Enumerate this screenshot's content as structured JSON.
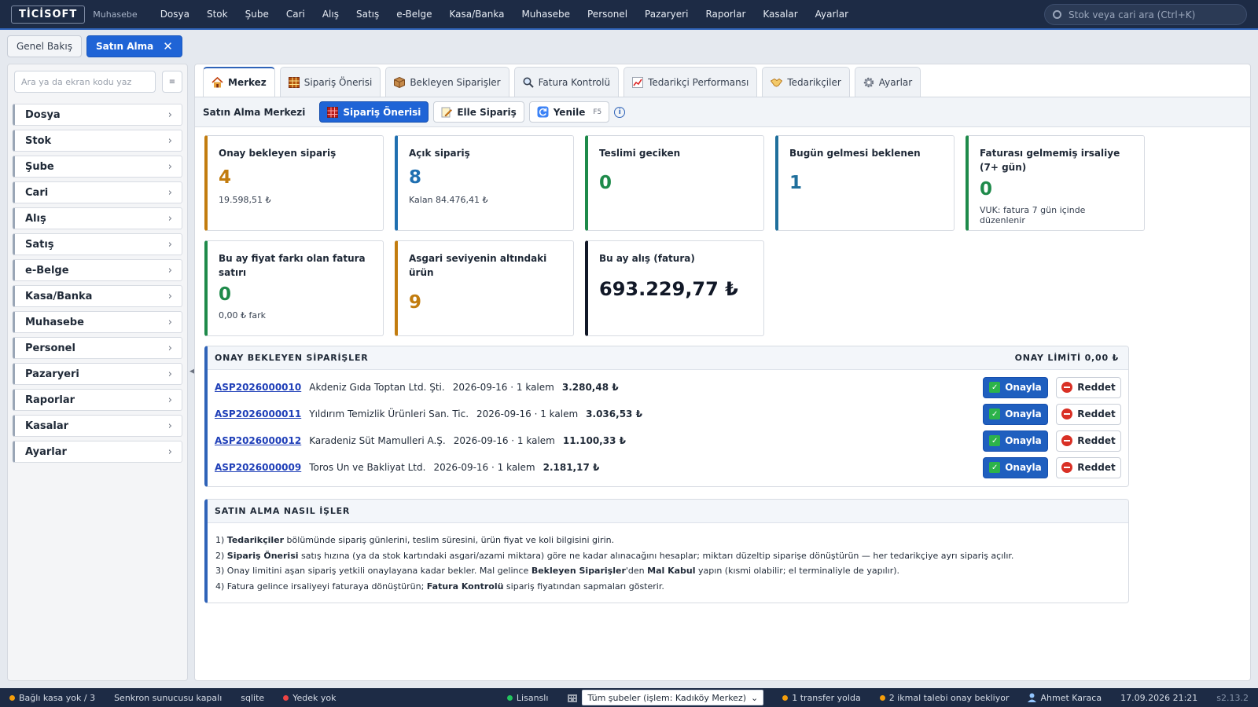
{
  "app": {
    "logo": "TİCİSOFT",
    "module": "Muhasebe"
  },
  "topnav": [
    "Dosya",
    "Stok",
    "Şube",
    "Cari",
    "Alış",
    "Satış",
    "e-Belge",
    "Kasa/Banka",
    "Muhasebe",
    "Personel",
    "Pazaryeri",
    "Raporlar",
    "Kasalar",
    "Ayarlar"
  ],
  "search": {
    "placeholder": "Stok veya cari ara (Ctrl+K)"
  },
  "pagetabs": [
    {
      "label": "Genel Bakış"
    },
    {
      "label": "Satın Alma",
      "close": "✕"
    }
  ],
  "sidebar": {
    "search_placeholder": "Ara ya da ekran kodu yaz",
    "menu_glyph": "≡",
    "items": [
      "Dosya",
      "Stok",
      "Şube",
      "Cari",
      "Alış",
      "Satış",
      "e-Belge",
      "Kasa/Banka",
      "Muhasebe",
      "Personel",
      "Pazaryeri",
      "Raporlar",
      "Kasalar",
      "Ayarlar"
    ]
  },
  "module_tabs": [
    {
      "icon": "home-icon",
      "label": "Merkez"
    },
    {
      "icon": "grid-icon",
      "label": "Sipariş Önerisi"
    },
    {
      "icon": "package-icon",
      "label": "Bekleyen Siparişler"
    },
    {
      "icon": "magnifier-icon",
      "label": "Fatura Kontrolü"
    },
    {
      "icon": "chart-icon",
      "label": "Tedarikçi Performansı"
    },
    {
      "icon": "handshake-icon",
      "label": "Tedarikçiler"
    },
    {
      "icon": "gear-icon",
      "label": "Ayarlar"
    }
  ],
  "toolbar": {
    "title": "Satın Alma Merkezi",
    "suggest_label": "Sipariş Önerisi",
    "manual_label": "Elle Sipariş",
    "refresh_label": "Yenile",
    "refresh_key": "F5",
    "info_glyph": "i"
  },
  "kpis": [
    {
      "label": "Onay bekleyen sipariş",
      "value": "4",
      "sub": "19.598,51 ₺",
      "color": "#c27c0e"
    },
    {
      "label": "Açık sipariş",
      "value": "8",
      "sub": "Kalan 84.476,41 ₺",
      "color": "#1f6fb0"
    },
    {
      "label": "Teslimi geciken",
      "value": "0",
      "sub": "",
      "color": "#1e8a4a"
    },
    {
      "label": "Bugün gelmesi beklenen",
      "value": "1",
      "sub": "",
      "color": "#1f6f9c"
    },
    {
      "label": "Faturası gelmemiş irsaliye (7+ gün)",
      "value": "0",
      "sub": "VUK: fatura 7 gün içinde düzenlenir",
      "color": "#1e8a4a"
    },
    {
      "label": "Bu ay fiyat farkı olan fatura satırı",
      "value": "0",
      "sub": "0,00 ₺ fark",
      "color": "#1e8a4a"
    },
    {
      "label": "Asgari seviyenin altındaki ürün",
      "value": "9",
      "sub": "",
      "color": "#c27c0e"
    },
    {
      "label": "Bu ay alış (fatura)",
      "value": "693.229,77 ₺",
      "sub": "",
      "color": "#111827"
    }
  ],
  "pending": {
    "title": "ONAY BEKLEYEN SİPARİŞLER",
    "limit": "ONAY LİMİTİ 0,00 ₺",
    "approve_label": "Onayla",
    "reject_label": "Reddet",
    "check_glyph": "✓",
    "rows": [
      {
        "code": "ASP2026000010",
        "supplier": "Akdeniz Gıda Toptan Ltd. Şti.",
        "meta": "2026-09-16 · 1 kalem",
        "amount": "3.280,48 ₺"
      },
      {
        "code": "ASP2026000011",
        "supplier": "Yıldırım Temizlik Ürünleri San. Tic.",
        "meta": "2026-09-16 · 1 kalem",
        "amount": "3.036,53 ₺"
      },
      {
        "code": "ASP2026000012",
        "supplier": "Karadeniz Süt Mamulleri A.Ş.",
        "meta": "2026-09-16 · 1 kalem",
        "amount": "11.100,33 ₺"
      },
      {
        "code": "ASP2026000009",
        "supplier": "Toros Un ve Bakliyat Ltd.",
        "meta": "2026-09-16 · 1 kalem",
        "amount": "2.181,17 ₺"
      }
    ]
  },
  "howto": {
    "title": "SATIN ALMA NASIL İŞLER",
    "steps": [
      [
        {
          "t": "1) "
        },
        {
          "t": "Tedarikçiler",
          "b": true
        },
        {
          "t": " bölümünde sipariş günlerini, teslim süresini, ürün fiyat ve koli bilgisini girin."
        }
      ],
      [
        {
          "t": "2) "
        },
        {
          "t": "Sipariş Önerisi",
          "b": true
        },
        {
          "t": " satış hızına (ya da stok kartındaki asgari/azami miktara) göre ne kadar alınacağını hesaplar; miktarı düzeltip siparişe dönüştürün — her tedarikçiye ayrı sipariş açılır."
        }
      ],
      [
        {
          "t": "3) Onay limitini aşan sipariş yetkili onaylayana kadar bekler. Mal gelince "
        },
        {
          "t": "Bekleyen Siparişler",
          "b": true
        },
        {
          "t": "'den "
        },
        {
          "t": "Mal Kabul",
          "b": true
        },
        {
          "t": " yapın (kısmi olabilir; el terminaliyle de yapılır)."
        }
      ],
      [
        {
          "t": "4) Fatura gelince irsaliyeyi faturaya dönüştürün; "
        },
        {
          "t": "Fatura Kontrolü",
          "b": true
        },
        {
          "t": " sipariş fiyatından sapmaları gösterir."
        }
      ]
    ]
  },
  "statusbar": {
    "kasa": "Bağlı kasa yok / 3",
    "sync": "Senkron sunucusu kapalı",
    "db": "sqlite",
    "backup": "Yedek yok",
    "license": "Lisanslı",
    "branch_select": "Tüm şubeler (işlem: Kadıköy Merkez)",
    "transfer": "1 transfer yolda",
    "ikmal": "2 ikmal talebi onay bekliyor",
    "user": "Ahmet Karaca",
    "datetime": "17.09.2026 21:21",
    "version": "s2.13.2"
  }
}
